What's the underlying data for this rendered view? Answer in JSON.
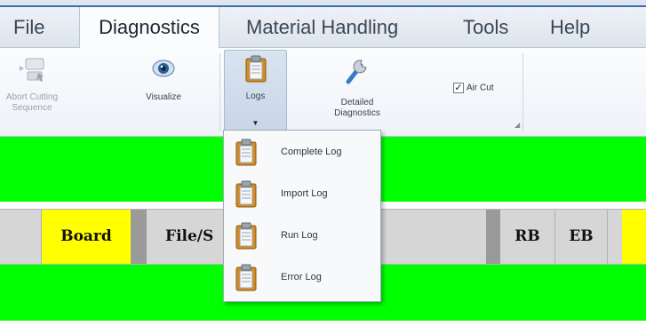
{
  "menu": {
    "items": [
      "File",
      "Diagnostics",
      "Material Handling",
      "Tools",
      "Help"
    ],
    "active": "Diagnostics"
  },
  "ribbon": {
    "abort_label": "Abort Cutting Sequence",
    "visualize_label": "Visualize",
    "logs_label": "Logs",
    "detailed_label": "Detailed Diagnostics",
    "aircut_label": "Air Cut",
    "aircut_checked": true
  },
  "logs_menu": {
    "items": [
      "Complete Log",
      "Import Log",
      "Run Log",
      "Error Log"
    ]
  },
  "grid_header": {
    "board": "Board",
    "file": "File/S",
    "rb": "RB",
    "eb": "EB"
  },
  "colors": {
    "status_green": "#00ff00",
    "highlight_yellow": "#ffff00",
    "header_gray": "#d6d6d6"
  }
}
